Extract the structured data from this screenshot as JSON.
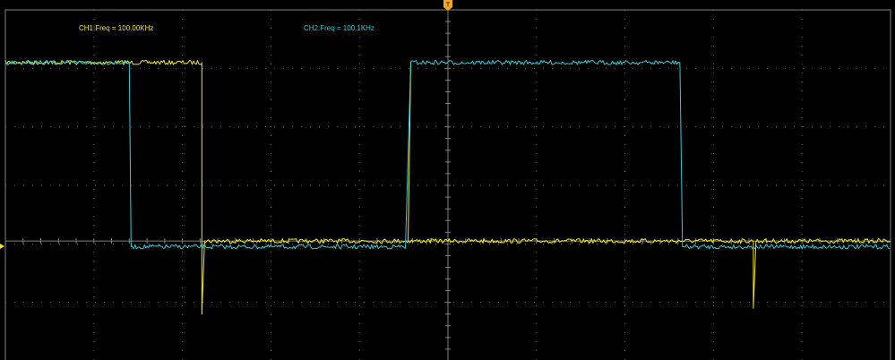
{
  "colors": {
    "background": "#000000",
    "grid": "#7f7f7f",
    "ch1": "#f2e623",
    "ch2": "#33cbd6",
    "trigger": "#f5a623"
  },
  "icons": {
    "trigger_marker": "trigger-t-icon",
    "level_marker": "channel-level-arrow-icon"
  },
  "readouts": {
    "ch1": "CH1:Freq = 100.00KHz",
    "ch2": "CH2:Freq = 100.1KHz"
  },
  "trigger": {
    "label": "T"
  },
  "chart_data": {
    "type": "line",
    "grid": true,
    "grid_divisions": {
      "x": 10,
      "y": 6
    },
    "xlim": [
      0,
      10
    ],
    "ylim": [
      0,
      6
    ],
    "series": [
      {
        "channel": "CH1",
        "color": "#f2e623",
        "high": 5.1,
        "low": 2.05,
        "points": [
          [
            0,
            5.1
          ],
          [
            2.22,
            5.1
          ],
          [
            2.22,
            0.8
          ],
          [
            2.25,
            2.05
          ],
          [
            8.45,
            2.05
          ],
          [
            8.45,
            0.9
          ],
          [
            8.48,
            2.05
          ],
          [
            10,
            2.05
          ]
        ],
        "rising_edges": [
          [
            4.55,
            2.05
          ],
          [
            4.58,
            5.1
          ]
        ]
      },
      {
        "channel": "CH2",
        "color": "#33cbd6",
        "high": 5.1,
        "low": 1.95,
        "points": [
          [
            0,
            5.1
          ],
          [
            1.4,
            5.1
          ],
          [
            1.42,
            1.95
          ],
          [
            4.52,
            1.95
          ],
          [
            4.58,
            5.1
          ],
          [
            7.62,
            5.1
          ],
          [
            7.65,
            1.95
          ],
          [
            10,
            1.95
          ]
        ]
      }
    ]
  }
}
